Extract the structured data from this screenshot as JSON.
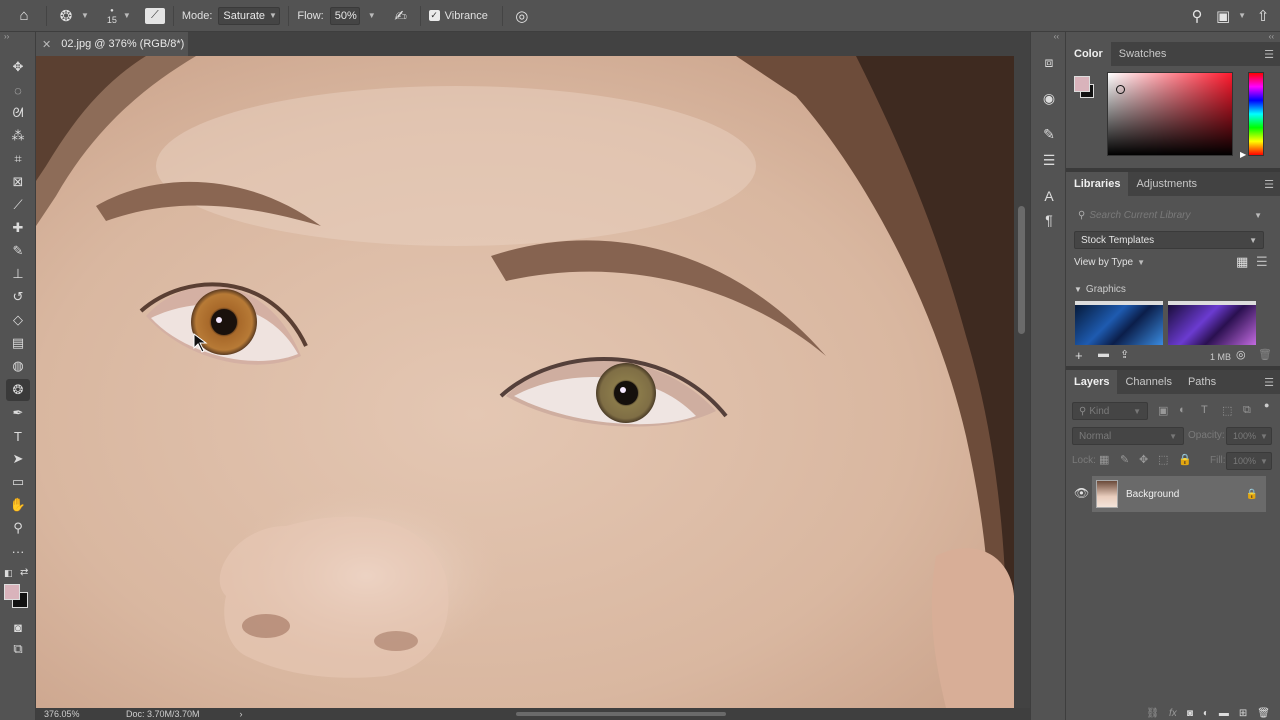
{
  "options_bar": {
    "brush_size": "15",
    "mode_label": "Mode:",
    "mode_value": "Saturate",
    "flow_label": "Flow:",
    "flow_value": "50%",
    "vibrance_label": "Vibrance",
    "vibrance_checked": true
  },
  "document": {
    "tab_title": "02.jpg @ 376% (RGB/8*)",
    "zoom_status": "376.05%",
    "doc_status": "Doc: 3.70M/3.70M"
  },
  "toolbar": {
    "tools": [
      {
        "name": "move-tool",
        "glyph": "✥"
      },
      {
        "name": "marquee-tool",
        "glyph": "◌"
      },
      {
        "name": "lasso-tool",
        "glyph": "ᘛ"
      },
      {
        "name": "magic-wand-tool",
        "glyph": "⁂"
      },
      {
        "name": "crop-tool",
        "glyph": "⌗"
      },
      {
        "name": "frame-tool",
        "glyph": "⊠"
      },
      {
        "name": "eyedropper-tool",
        "glyph": "⟋"
      },
      {
        "name": "healing-brush-tool",
        "glyph": "✚"
      },
      {
        "name": "brush-tool",
        "glyph": "✎"
      },
      {
        "name": "clone-stamp-tool",
        "glyph": "⊥"
      },
      {
        "name": "history-brush-tool",
        "glyph": "↺"
      },
      {
        "name": "eraser-tool",
        "glyph": "◇"
      },
      {
        "name": "gradient-tool",
        "glyph": "▤"
      },
      {
        "name": "blur-tool",
        "glyph": "◍"
      },
      {
        "name": "sponge-tool",
        "glyph": "❂",
        "active": true
      },
      {
        "name": "pen-tool",
        "glyph": "✒"
      },
      {
        "name": "type-tool",
        "glyph": "T"
      },
      {
        "name": "path-selection-tool",
        "glyph": "➤"
      },
      {
        "name": "rectangle-tool",
        "glyph": "▭"
      },
      {
        "name": "hand-tool",
        "glyph": "✋"
      },
      {
        "name": "zoom-tool",
        "glyph": "⚲"
      },
      {
        "name": "more-tools",
        "glyph": "···"
      }
    ]
  },
  "color_panel": {
    "tabs": [
      "Color",
      "Swatches"
    ],
    "active_tab": "Color",
    "foreground": "#d9b3bb",
    "background": "#111111"
  },
  "libraries_panel": {
    "tabs": [
      "Libraries",
      "Adjustments"
    ],
    "active_tab": "Libraries",
    "search_placeholder": "Search Current Library",
    "library_select": "Stock Templates",
    "view_by": "View by Type",
    "section": "Graphics",
    "storage": "1 MB"
  },
  "layers_panel": {
    "tabs": [
      "Layers",
      "Channels",
      "Paths"
    ],
    "active_tab": "Layers",
    "kind_placeholder": "Kind",
    "blend_mode": "Normal",
    "opacity_label": "Opacity:",
    "opacity_value": "100%",
    "lock_label": "Lock:",
    "fill_label": "Fill:",
    "fill_value": "100%",
    "layers": [
      {
        "name": "Background",
        "visible": true,
        "locked": true
      }
    ]
  }
}
